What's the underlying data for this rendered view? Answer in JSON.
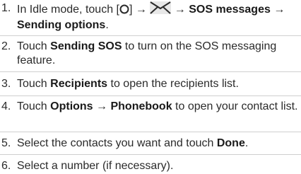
{
  "steps": [
    {
      "num": "1.",
      "lead": "In Idle mode, touch [",
      "close_bracket": "] →",
      "arrow1": "→",
      "bold1": "SOS messages",
      "arrow2": "→",
      "bold2": "Sending options",
      "end": ".",
      "icon_circle": "home-key-icon",
      "icon_envelope": "messages-icon"
    },
    {
      "num": "2.",
      "pre": "Touch ",
      "bold": "Sending SOS",
      "post": " to turn on the SOS messaging feature."
    },
    {
      "num": "3.",
      "pre": "Touch ",
      "bold": "Recipients",
      "post": " to open the recipients list."
    },
    {
      "num": "4.",
      "pre": "Touch ",
      "bold": "Options",
      "arrow": "→",
      "bold2": "Phonebook",
      "post": " to open your contact list."
    },
    {
      "num": "5.",
      "pre": "Select the contacts you want and touch ",
      "bold": "Done",
      "post": "."
    },
    {
      "num": "6.",
      "text": "Select a number (if necessary)."
    }
  ]
}
